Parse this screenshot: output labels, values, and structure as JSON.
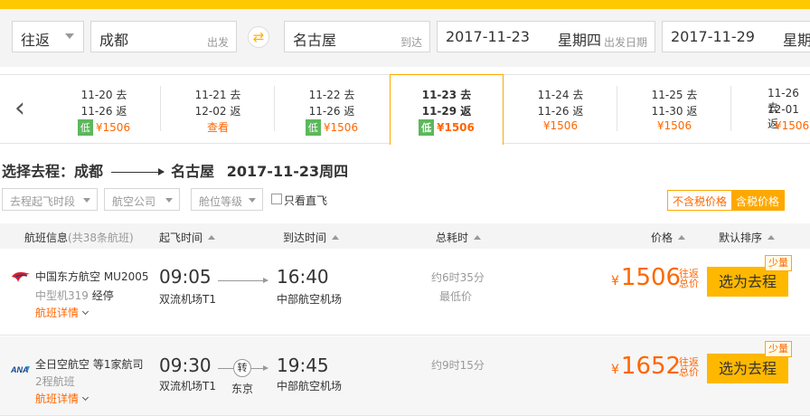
{
  "search": {
    "trip_type": "往返",
    "from_city": "成都",
    "from_label": "出发",
    "swap_icon": "⇄",
    "to_city": "名古屋",
    "to_label": "到达",
    "depart_date": "2017-11-23",
    "depart_weekday": "星期四",
    "depart_label": "出发日期",
    "return_date": "2017-11-29",
    "return_weekday": "星期"
  },
  "date_strip": {
    "prev_icon": "chevron-left-icon",
    "items": [
      {
        "go": "11-20 去",
        "ret": "11-26 返",
        "low_tag": "低",
        "price": "¥1506",
        "low": true
      },
      {
        "go": "11-21 去",
        "ret": "12-02 返",
        "low_tag": "",
        "price": "查看",
        "low": false
      },
      {
        "go": "11-22 去",
        "ret": "11-26 返",
        "low_tag": "低",
        "price": "¥1506",
        "low": true
      },
      {
        "go": "11-23 去",
        "ret": "11-29 返",
        "low_tag": "低",
        "price": "¥1506",
        "low": true
      },
      {
        "go": "11-24 去",
        "ret": "11-26 返",
        "low_tag": "",
        "price": "¥1506",
        "low": false
      },
      {
        "go": "11-25 去",
        "ret": "11-30 返",
        "low_tag": "",
        "price": "¥1506",
        "low": false
      },
      {
        "go": "11-26 去",
        "ret": "12-01 返",
        "low_tag": "",
        "price": "¥1506",
        "low": false
      }
    ]
  },
  "heading": {
    "prefix": "选择去程：成都",
    "dest": "名古屋",
    "date": "2017-11-23周四"
  },
  "filters": {
    "depart_time": "去程起飞时段",
    "airline": "航空公司",
    "cabin": "舱位等级",
    "direct_only": "只看直飞",
    "tax_excluded": "不含税价格",
    "tax_included": "含税价格"
  },
  "table_header": {
    "flight_info": "航班信息",
    "flight_count": "(共38条航班)",
    "depart_time": "起飞时间",
    "arrive_time": "到达时间",
    "duration": "总耗时",
    "price": "价格",
    "sort": "默认排序"
  },
  "flights": [
    {
      "airline": "中国东方航空 MU2005",
      "plane_type": "中型机319",
      "stop_note": "经停",
      "detail": "航班详情",
      "dep_time": "09:05",
      "dep_airport": "双流机场T1",
      "arr_time": "16:40",
      "arr_airport": "中部航空机场",
      "transfer_tag": "",
      "transfer_city": "",
      "duration": "约6时35分",
      "tag": "最低价",
      "price_symbol": "¥",
      "price": "1506",
      "tax_line1": "往返",
      "tax_line2": "总价",
      "button": "选为去程",
      "badge": "少量"
    },
    {
      "airline": "全日空航空 等1家航司",
      "plane_type": "2程航班",
      "stop_note": "",
      "detail": "航班详情",
      "dep_time": "09:30",
      "dep_airport": "双流机场T1",
      "arr_time": "19:45",
      "arr_airport": "中部航空机场",
      "transfer_tag": "转",
      "transfer_city": "东京",
      "duration": "约9时15分",
      "tag": "",
      "price_symbol": "¥",
      "price": "1652",
      "tax_line1": "往返",
      "tax_line2": "总价",
      "button": "选为去程",
      "badge": "少量"
    }
  ],
  "colors": {
    "accent": "#ffb800",
    "price": "#ff6600",
    "low_tag": "#5cb85c"
  }
}
